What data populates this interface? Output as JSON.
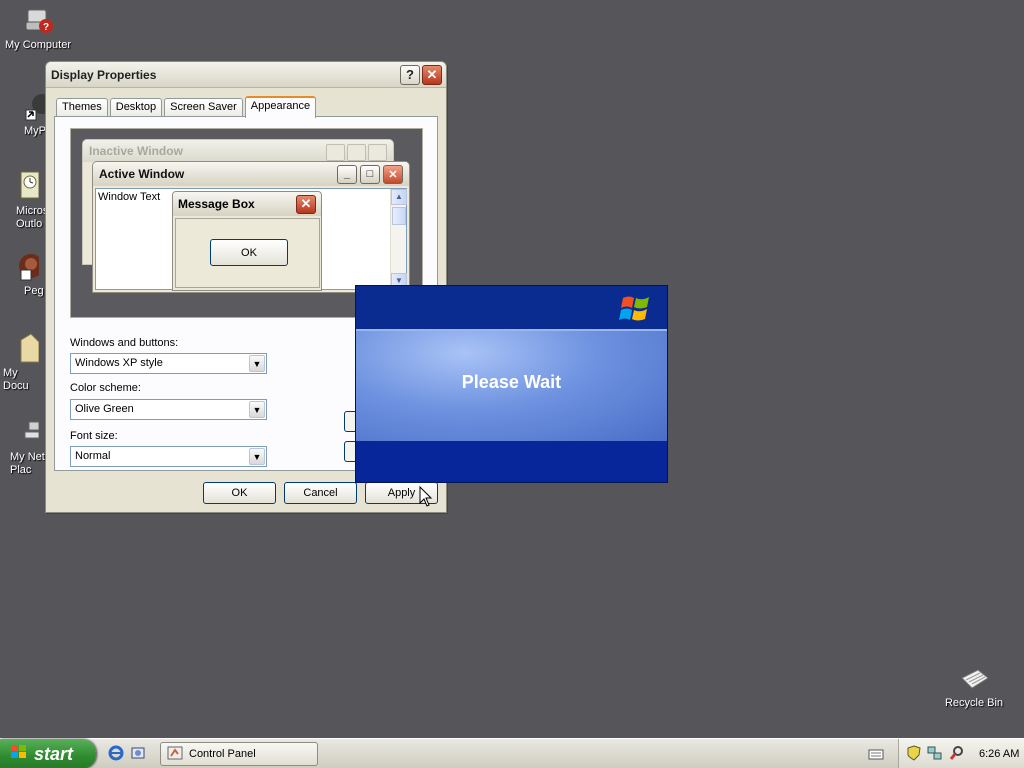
{
  "desktop": {
    "icons": [
      {
        "label": "My Computer"
      },
      {
        "label": "MyPa"
      },
      {
        "label": "Micros\nOutlo"
      },
      {
        "label": "Peg"
      },
      {
        "label": "My Docu"
      },
      {
        "label": "My Net\nPlac"
      },
      {
        "label": "Recycle Bin"
      }
    ]
  },
  "dialog": {
    "title": "Display Properties",
    "help_label": "?",
    "tabs": [
      "Themes",
      "Desktop",
      "Screen Saver",
      "Appearance"
    ],
    "active_tab": "Appearance",
    "preview": {
      "inactive_title": "Inactive Window",
      "active_title": "Active Window",
      "window_text": "Window Text",
      "message_box_title": "Message Box",
      "message_box_ok": "OK"
    },
    "windows_buttons_label": "Windows and buttons:",
    "windows_buttons_value": "Windows XP style",
    "color_scheme_label": "Color scheme:",
    "color_scheme_value": "Olive Green",
    "font_size_label": "Font size:",
    "font_size_value": "Normal",
    "ok_label": "OK",
    "cancel_label": "Cancel",
    "apply_label": "Apply"
  },
  "splash": {
    "message": "Please Wait"
  },
  "taskbar": {
    "start_label": "start",
    "window_button": "Control Panel",
    "clock": "6:26 AM"
  },
  "colors": {
    "desktop": "#55555a",
    "splash_dark": "#0a2b8f",
    "splash_light": "#6f93e0",
    "start_green": "#2f8a2f",
    "close_red": "#b5371e"
  }
}
